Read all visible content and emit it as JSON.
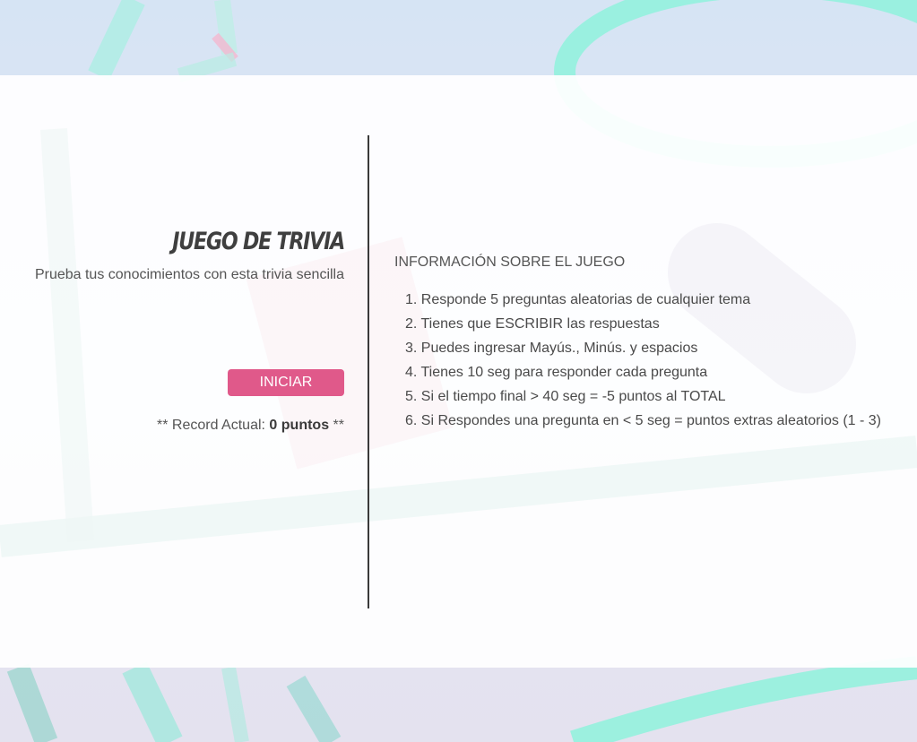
{
  "header": {
    "title": "JUEGO DE TRIVIA",
    "subtitle": "Prueba tus conocimientos con esta trivia sencilla"
  },
  "start_button": {
    "label": "INICIAR"
  },
  "record": {
    "prefix": "** Record Actual: ",
    "value": "0 puntos",
    "suffix": " **"
  },
  "info": {
    "title": "INFORMACIÓN SOBRE EL JUEGO",
    "rules": [
      "1. Responde 5 preguntas aleatorias de cualquier tema",
      "2. Tienes que ESCRIBIR las respuestas",
      "3. Puedes ingresar Mayús., Minús. y espacios",
      "4. Tienes 10 seg para responder cada pregunta",
      "5. Si el tiempo final > 40 seg = -5 puntos al TOTAL",
      "6. Si Respondes una pregunta en < 5 seg = puntos extras aleatorios (1 - 3)"
    ]
  },
  "colors": {
    "accent": "#e0598a",
    "background_top": "#d6e4f4",
    "decor_mint": "#8ff2dc"
  }
}
